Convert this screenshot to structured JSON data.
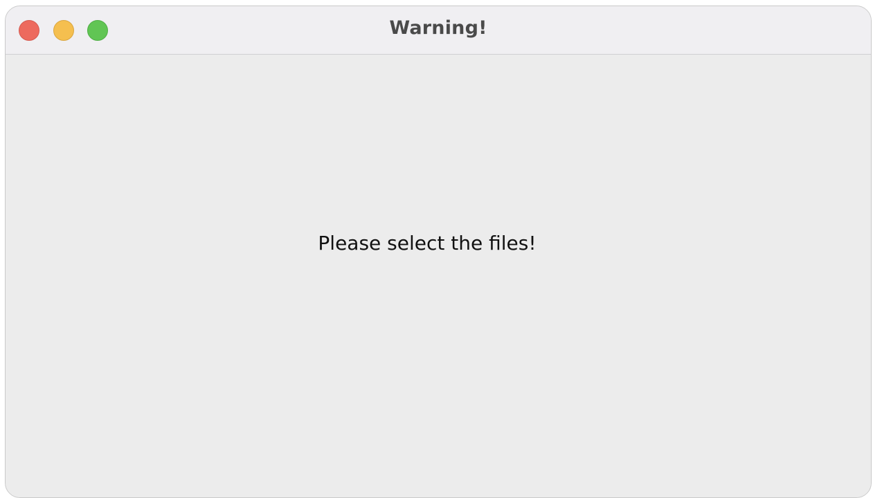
{
  "window": {
    "title": "Warning!",
    "message": "Please select the files!"
  },
  "traffic_lights": {
    "close_color": "#ed6a5e",
    "minimize_color": "#f5bf4f",
    "zoom_color": "#61c554"
  }
}
